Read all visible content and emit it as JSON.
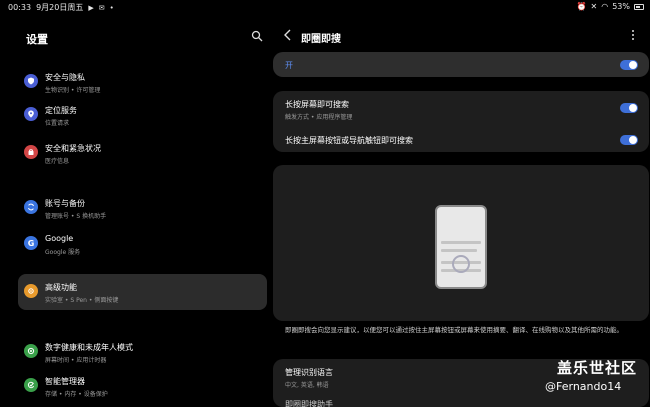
{
  "status_bar": {
    "time": "00:33",
    "date": "9月20日周五",
    "battery": "53%"
  },
  "settings": {
    "title": "设置",
    "items": [
      {
        "title": "安全与隐私",
        "subtitle": "生物识别 • 许可管理",
        "color": "#4a5ed4",
        "icon": "shield-icon"
      },
      {
        "title": "定位服务",
        "subtitle": "位置请求",
        "color": "#4a5ed4",
        "icon": "location-icon"
      },
      {
        "title": "安全和紧急状况",
        "subtitle": "医疗信息",
        "color": "#d24646",
        "icon": "emergency-icon"
      },
      {
        "title": "账号与备份",
        "subtitle": "管理账号 • S 换机助手",
        "color": "#3a74e0",
        "icon": "sync-icon"
      },
      {
        "title": "Google",
        "subtitle": "Google 服务",
        "color": "#3a74e0",
        "icon": "google-icon",
        "glyph": "G"
      },
      {
        "title": "高级功能",
        "subtitle": "实验室 • S Pen • 侧面按键",
        "color": "#e89a2c",
        "icon": "advanced-features-icon"
      },
      {
        "title": "数字健康和未成年人模式",
        "subtitle": "屏幕时间 • 应用计时器",
        "color": "#3aa04a",
        "icon": "digital-wellbeing-icon"
      },
      {
        "title": "智能管理器",
        "subtitle": "存储 • 内存 • 设备保护",
        "color": "#3aa04a",
        "icon": "device-care-icon"
      }
    ]
  },
  "detail": {
    "title": "即圈即搜",
    "master_label": "开",
    "options": [
      {
        "title": "长按屏幕即可搜索",
        "subtitle": "触发方式 • 应用程序管理"
      },
      {
        "title": "长按主屏幕按钮或导航触钮即可搜索",
        "subtitle": ""
      }
    ],
    "description": "即圈即搜会向您显示建议，以便您可以通过按住主屏幕按钮或屏幕来使用摘要、翻译、在线购物以及其他所需的功能。",
    "language": {
      "title": "管理识别语言",
      "subtitle": "中文, 英语, 韩语"
    },
    "next_partial": "即圈即搜助手"
  },
  "watermark": {
    "line1": "盖乐世社区",
    "line2": "@Fernando14"
  },
  "accent_color": "#3e6fd8"
}
